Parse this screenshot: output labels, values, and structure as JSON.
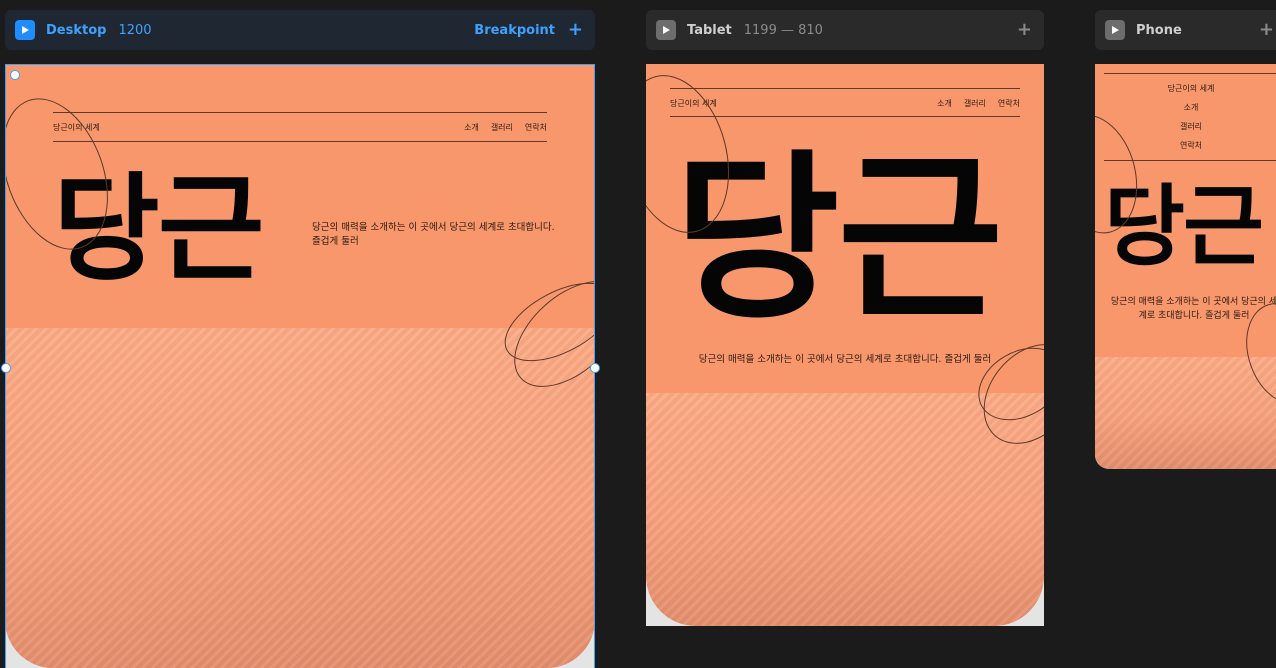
{
  "colors": {
    "canvas": "#1b1b1b",
    "accent": "#3ea1ff",
    "hero_bg": "#f7976b",
    "text_dark": "#050505"
  },
  "breakpoints": [
    {
      "name": "Desktop",
      "range": "1200",
      "icon": "play-icon"
    },
    {
      "name": "Tablet",
      "range": "1199 — 810",
      "icon": "play-icon"
    },
    {
      "name": "Phone",
      "range": "",
      "icon": "play-icon"
    }
  ],
  "toolbar": {
    "breakpoint_label": "Breakpoint",
    "add_icon": "plus-icon"
  },
  "site": {
    "title": "당근이의 세계",
    "nav": [
      "소개",
      "갤러리",
      "연락처"
    ],
    "hero_heading": "당근",
    "description": "당근의 매력을 소개하는 이 곳에서 당근의 세계로 초대합니다. 즐겁게 둘러",
    "description_desktop_lines": [
      "당근의 매력을 소개하는 이 곳에서 당근의 세계로 초대합니다.",
      "즐겁게 둘러"
    ],
    "description_phone_lines": [
      "당근의 매력을 소개하는 이 곳에서 당근의 세",
      "계로 초대합니다. 즐겁게 둘러"
    ]
  }
}
